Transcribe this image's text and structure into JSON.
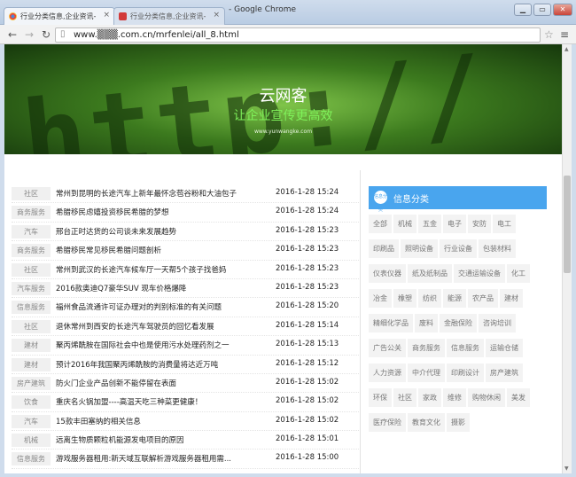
{
  "browser": {
    "tabs": [
      {
        "label": "行业分类信息,企业资讯-",
        "active": true
      },
      {
        "label": "行业分类信息,企业资讯-",
        "active": false
      }
    ],
    "window_title": "- Google Chrome",
    "url": "www.▒▒▒.com.cn/mrfenlei/all_8.html",
    "buttons": {
      "minimize": "▁",
      "maximize": "▭",
      "close": "✕"
    }
  },
  "banner": {
    "title": "云网客",
    "slogan": "让企业宣传更高效",
    "site_url": "www.yunwangke.com",
    "decoration": "http://"
  },
  "news": [
    {
      "category": "社区",
      "title": "常州到昆明的长途汽车上新年最怀念苞谷粉和大油包子",
      "date": "2016-1-28 15:24"
    },
    {
      "category": "商务服务",
      "title": "希腊移民虑嬉投资移民希腊的梦想",
      "date": "2016-1-28 15:24"
    },
    {
      "category": "汽车",
      "title": "邢台正时达货的公司谈未来发展趋势",
      "date": "2016-1-28 15:23"
    },
    {
      "category": "商务服务",
      "title": "希腊移民常见移民希腊问题剖析",
      "date": "2016-1-28 15:23"
    },
    {
      "category": "社区",
      "title": "常州到武汉的长途汽车候车厅一天帮5个孩子找爸妈",
      "date": "2016-1-28 15:23"
    },
    {
      "category": "汽车服务",
      "title": "2016款奥迪Q7豪华SUV 现车价格爆降",
      "date": "2016-1-28 15:23"
    },
    {
      "category": "信息服务",
      "title": "福州食品流通许可证办理对的判别标准的有关问题",
      "date": "2016-1-28 15:20"
    },
    {
      "category": "社区",
      "title": "退休常州到西安的长途汽车驾驶员的回忆看发展",
      "date": "2016-1-28 15:14"
    },
    {
      "category": "建材",
      "title": "聚丙烯酰胺在国际社会中也是使用污水处理药剂之一",
      "date": "2016-1-28 15:13"
    },
    {
      "category": "建材",
      "title": "预计2016年我国聚丙烯酰胺的消费量将达近万吨",
      "date": "2016-1-28 15:12"
    },
    {
      "category": "房产建筑",
      "title": "防火门企业产品创新不能停留在表面",
      "date": "2016-1-28 15:02"
    },
    {
      "category": "饮食",
      "title": "重庆名火锅加盟----高温天吃三种菜更健康！",
      "date": "2016-1-28 15:02"
    },
    {
      "category": "汽车",
      "title": "15款丰田塞纳的相关信息",
      "date": "2016-1-28 15:02"
    },
    {
      "category": "机械",
      "title": "远离生物质颗粒机能源发电项目的原因",
      "date": "2016-1-28 15:01"
    },
    {
      "category": "信息服务",
      "title": "游戏服务器租用:新天域互联解析游戏服务器租用需...",
      "date": "2016-1-28 15:00"
    }
  ],
  "sidebar": {
    "header_icon_text": "信息分类",
    "header": "信息分类",
    "tags": [
      "全部",
      "机械",
      "五金",
      "电子",
      "安防",
      "电工",
      "印刷品",
      "照明设备",
      "行业设备",
      "包装材料",
      "仪表仪器",
      "纸及纸制品",
      "交通运输设备",
      "化工",
      "冶金",
      "橡塑",
      "纺织",
      "能源",
      "农产品",
      "建材",
      "精细化学品",
      "废料",
      "金融保险",
      "咨询培训",
      "广告公关",
      "商务服务",
      "信息服务",
      "运输仓储",
      "人力资源",
      "中介代理",
      "印刷设计",
      "房产建筑",
      "环保",
      "社区",
      "家政",
      "维修",
      "购物休闲",
      "美发",
      "医疗保险",
      "教育文化",
      "摄影"
    ]
  }
}
